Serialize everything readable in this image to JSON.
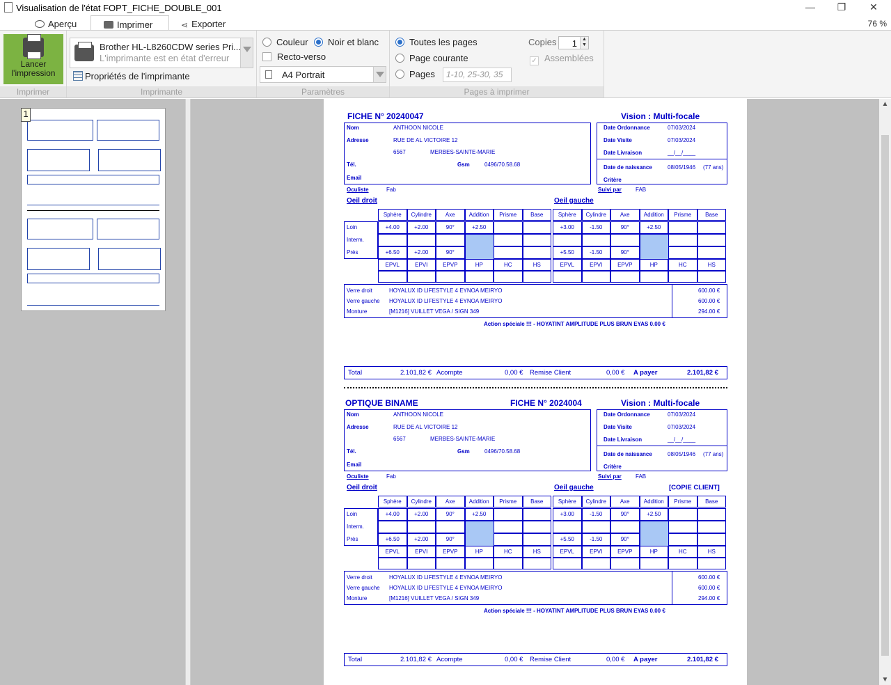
{
  "window": {
    "title": "Visualisation de l'état FOPT_FICHE_DOUBLE_001",
    "zoom": "76 %"
  },
  "tabs": [
    {
      "label": "Aperçu"
    },
    {
      "label": "Imprimer"
    },
    {
      "label": "Exporter"
    }
  ],
  "ribbon": {
    "print_button": "Lancer l'impression",
    "printer_name": "Brother HL-L8260CDW series Pri...",
    "printer_status": "L'imprimante est en état d'erreur",
    "printer_props": "Propriétés de l'imprimante",
    "color": "Couleur",
    "bw": "Noir et blanc",
    "duplex": "Recto-verso",
    "paper": "A4 Portrait",
    "all_pages": "Toutes les pages",
    "current_page": "Page courante",
    "pages": "Pages",
    "pages_placeholder": "1-10, 25-30, 35",
    "copies_label": "Copies",
    "copies_value": "1",
    "collate": "Assemblées",
    "groups": [
      "Imprimer",
      "Imprimante",
      "Paramètres",
      "Pages à imprimer"
    ]
  },
  "thumbnail": {
    "page_number": "1"
  },
  "doc": {
    "fiche1": {
      "title": "FICHE N° 20240047",
      "vision": "Vision : Multi-focale"
    },
    "fiche2": {
      "shop": "OPTIQUE BINAME",
      "title": "FICHE N° 2024004",
      "vision": "Vision : Multi-focale",
      "copy": "[COPIE CLIENT]"
    },
    "labels": {
      "nom": "Nom",
      "adresse": "Adresse",
      "tel": "Tél.",
      "gsm": "Gsm",
      "email": "Email",
      "date_ord": "Date Ordonnance",
      "date_visite": "Date Visite",
      "date_livraison": "Date Livraison",
      "date_naissance": "Date de naissance",
      "critere": "Critère",
      "oculiste": "Oculiste",
      "suivi_par": "Suivi par",
      "oeil_droit": "Oeil droit",
      "oeil_gauche": "Oeil gauche",
      "verre_droit": "Verre droit",
      "verre_gauche": "Verre gauche",
      "monture": "Monture",
      "total": "Total",
      "acompte": "Acompte",
      "remise": "Remise Client",
      "a_payer": "A payer"
    },
    "values": {
      "nom": "ANTHOON NICOLE",
      "adresse": "RUE DE AL VICTOIRE 12",
      "cp": "6567",
      "ville": "MERBES-SAINTE-MARIE",
      "gsm": "0496/70.58.68",
      "date_ord": "07/03/2024",
      "date_visite": "07/03/2024",
      "date_livraison": "__/__/____",
      "date_naissance": "08/05/1946",
      "age": "(77 ans)",
      "oculiste": "Fab",
      "suivi_par": "FAB",
      "verre_droit": "HOYALUX ID LIFESTYLE 4 EYNOA MEIRYO",
      "verre_gauche": "HOYALUX ID LIFESTYLE 4 EYNOA MEIRYO",
      "monture": "[M1216] VUILLET VEGA / SIGN 349",
      "prix_vd": "600.00 €",
      "prix_vg": "600.00 €",
      "prix_mont": "294.00 €",
      "action": "Action spéciale !!! - HOYATINT AMPLITUDE PLUS BRUN EYAS  0.00 €",
      "total": "2.101,82 €",
      "acompte": "0,00 €",
      "remise": "0,00 €",
      "a_payer": "2.101,82 €"
    },
    "rx_cols": [
      "Sphère",
      "Cylindre",
      "Axe",
      "Addition",
      "Prisme",
      "Base"
    ],
    "rx_rows": [
      "Loin",
      "Interm.",
      "Près"
    ],
    "rx_cols2": [
      "EPVL",
      "EPVI",
      "EPVP",
      "HP",
      "HC",
      "HS"
    ],
    "od": {
      "loin": [
        "+4.00",
        "+2.00",
        "90°",
        "+2.50",
        "",
        ""
      ],
      "pres": [
        "+6.50",
        "+2.00",
        "90°",
        "",
        "",
        ""
      ]
    },
    "og": {
      "loin": [
        "+3.00",
        "-1.50",
        "90°",
        "+2.50",
        "",
        ""
      ],
      "pres": [
        "+5.50",
        "-1.50",
        "90°",
        "",
        "",
        ""
      ]
    }
  }
}
